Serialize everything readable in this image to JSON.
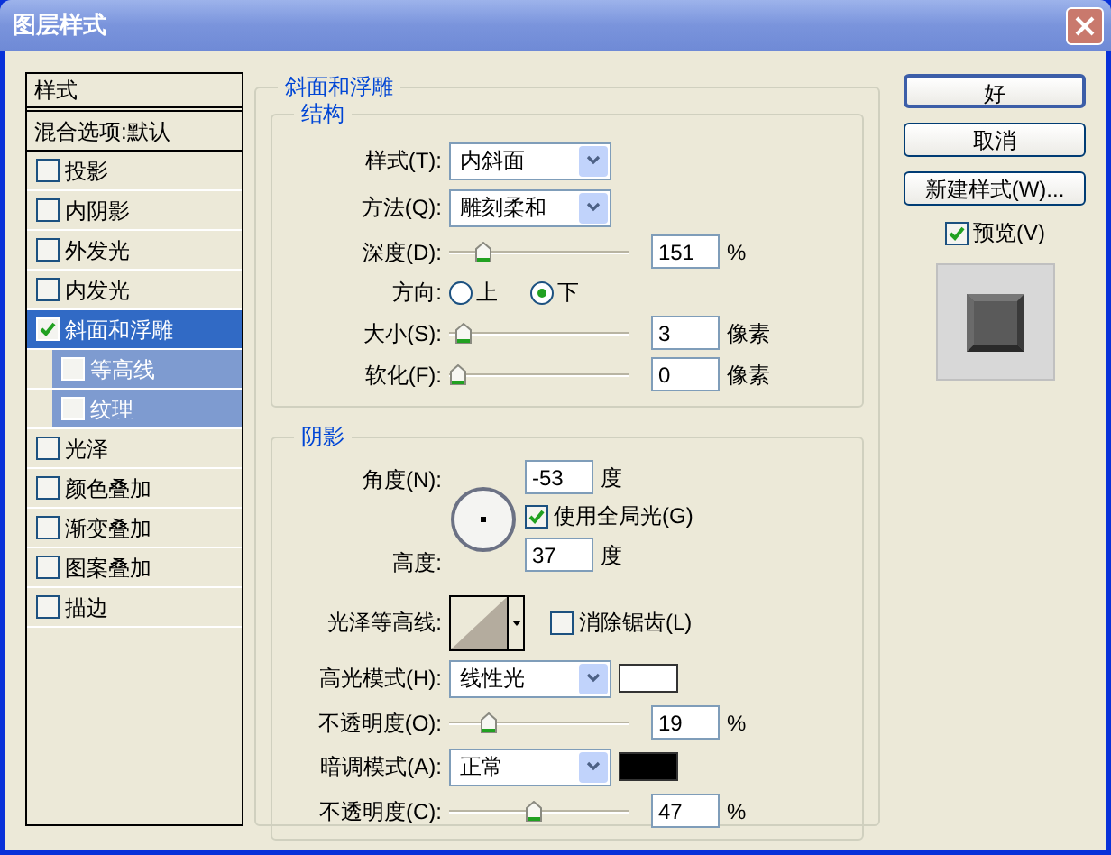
{
  "window": {
    "title": "图层样式"
  },
  "styles_list": {
    "header": "样式",
    "blend_options": "混合选项:默认",
    "items": [
      {
        "label": "投影",
        "checked": false,
        "selected": false
      },
      {
        "label": "内阴影",
        "checked": false,
        "selected": false
      },
      {
        "label": "外发光",
        "checked": false,
        "selected": false
      },
      {
        "label": "内发光",
        "checked": false,
        "selected": false
      },
      {
        "label": "斜面和浮雕",
        "checked": true,
        "selected": true,
        "children": [
          {
            "label": "等高线",
            "checked": false
          },
          {
            "label": "纹理",
            "checked": false
          }
        ]
      },
      {
        "label": "光泽",
        "checked": false,
        "selected": false
      },
      {
        "label": "颜色叠加",
        "checked": false,
        "selected": false
      },
      {
        "label": "渐变叠加",
        "checked": false,
        "selected": false
      },
      {
        "label": "图案叠加",
        "checked": false,
        "selected": false
      },
      {
        "label": "描边",
        "checked": false,
        "selected": false
      }
    ]
  },
  "bevel": {
    "title": "斜面和浮雕",
    "structure": {
      "title": "结构",
      "style": {
        "label": "样式(T):",
        "value": "内斜面"
      },
      "technique": {
        "label": "方法(Q):",
        "value": "雕刻柔和"
      },
      "depth": {
        "label": "深度(D):",
        "level": 0.15,
        "value": "151",
        "unit": "%"
      },
      "direction": {
        "label": "方向:",
        "options": [
          {
            "label": "上",
            "selected": false
          },
          {
            "label": "下",
            "selected": true
          }
        ]
      },
      "size": {
        "label": "大小(S):",
        "level": 0.03,
        "value": "3",
        "unit": "像素"
      },
      "soften": {
        "label": "软化(F):",
        "level": 0,
        "value": "0",
        "unit": "像素"
      }
    },
    "shading": {
      "title": "阴影",
      "angle": {
        "label": "角度(N):",
        "value": "-53",
        "unit": "度"
      },
      "global_light": {
        "label": "使用全局光(G)",
        "checked": true
      },
      "altitude": {
        "label": "高度:",
        "value": "37",
        "unit": "度"
      },
      "gloss_contour": {
        "label": "光泽等高线:"
      },
      "anti_aliased": {
        "label": "消除锯齿(L)",
        "checked": false
      },
      "highlight_mode": {
        "label": "高光模式(H):",
        "value": "线性光",
        "color": "#ffffff"
      },
      "highlight_opacity": {
        "label": "不透明度(O):",
        "level": 0.19,
        "value": "19",
        "unit": "%"
      },
      "shadow_mode": {
        "label": "暗调模式(A):",
        "value": "正常",
        "color": "#000000"
      },
      "shadow_opacity": {
        "label": "不透明度(C):",
        "level": 0.47,
        "value": "47",
        "unit": "%"
      }
    }
  },
  "buttons": [
    {
      "label": "好",
      "default": true
    },
    {
      "label": "取消",
      "default": false
    },
    {
      "label": "新建样式(W)...",
      "default": false
    }
  ],
  "preview": {
    "label": "预览(V)",
    "checked": true
  }
}
